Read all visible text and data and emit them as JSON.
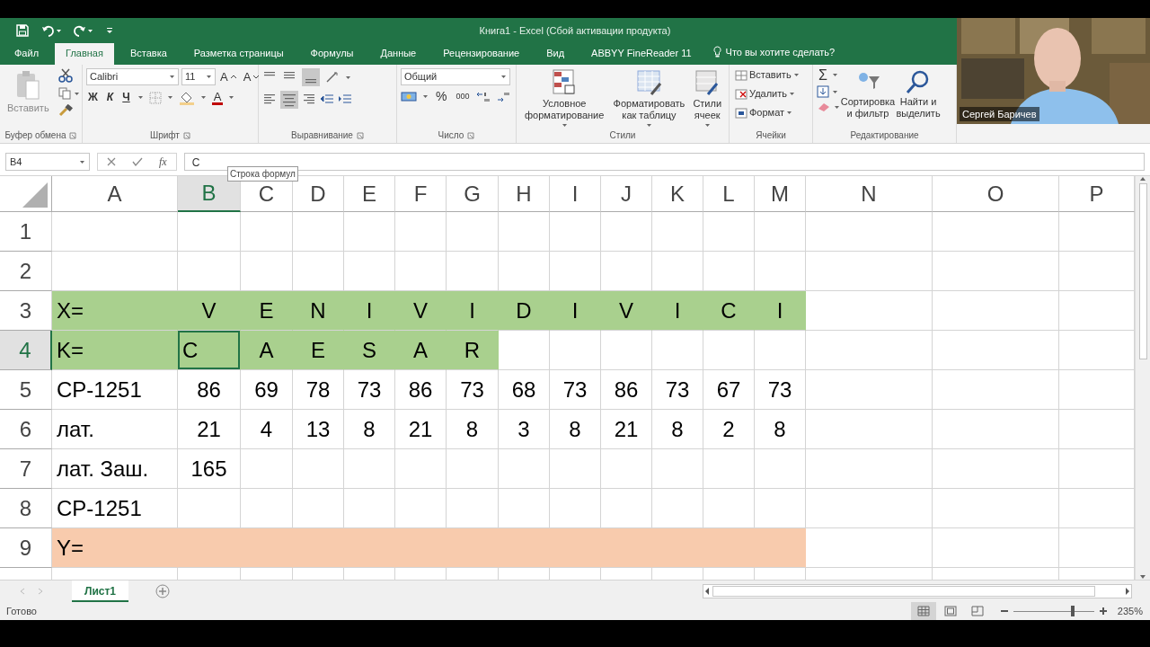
{
  "window": {
    "title": "Книга1 - Excel (Сбой активации продукта)"
  },
  "tabs": [
    {
      "label": "Файл",
      "selected": false
    },
    {
      "label": "Главная",
      "selected": true
    },
    {
      "label": "Вставка",
      "selected": false
    },
    {
      "label": "Разметка страницы",
      "selected": false
    },
    {
      "label": "Формулы",
      "selected": false
    },
    {
      "label": "Данные",
      "selected": false
    },
    {
      "label": "Рецензирование",
      "selected": false
    },
    {
      "label": "Вид",
      "selected": false
    },
    {
      "label": "ABBYY FineReader 11",
      "selected": false
    }
  ],
  "tell_me": "Что вы хотите сделать?",
  "ribbon": {
    "clipboard": {
      "paste": "Вставить",
      "label": "Буфер обмена"
    },
    "font": {
      "name": "Calibri",
      "size": "11",
      "grow": "A",
      "shrink": "A",
      "bold": "Ж",
      "italic": "К",
      "underline": "Ч",
      "font_color": "A",
      "label": "Шрифт"
    },
    "alignment": {
      "label": "Выравнивание"
    },
    "number": {
      "format": "Общий",
      "percent": "%",
      "thousands": "000",
      "label": "Число"
    },
    "styles": {
      "buttons": [
        "Условное форматирование",
        "Форматировать как таблицу",
        "Стили ячеек"
      ],
      "label": "Стили"
    },
    "cells": {
      "buttons": [
        "Вставить",
        "Удалить",
        "Формат"
      ],
      "label": "Ячейки"
    },
    "editing": {
      "sum": "Σ",
      "buttons": [
        "Сортировка и фильтр",
        "Найти и выделить"
      ],
      "label": "Редактирование"
    }
  },
  "formula_bar": {
    "name_box": "B4",
    "function_button": "fx",
    "value": "C",
    "tooltip": "Строка формул"
  },
  "sheet": {
    "columns": [
      {
        "label": "A",
        "selected": false
      },
      {
        "label": "B",
        "selected": true
      },
      {
        "label": "C",
        "selected": false
      },
      {
        "label": "D",
        "selected": false
      },
      {
        "label": "E",
        "selected": false
      },
      {
        "label": "F",
        "selected": false
      },
      {
        "label": "G",
        "selected": false
      },
      {
        "label": "H",
        "selected": false
      },
      {
        "label": "I",
        "selected": false
      },
      {
        "label": "J",
        "selected": false
      },
      {
        "label": "K",
        "selected": false
      },
      {
        "label": "L",
        "selected": false
      },
      {
        "label": "M",
        "selected": false
      },
      {
        "label": "N",
        "selected": false
      },
      {
        "label": "O",
        "selected": false
      },
      {
        "label": "P",
        "selected": false
      }
    ],
    "rows": [
      {
        "number": "1",
        "selected": false,
        "cells": []
      },
      {
        "number": "2",
        "selected": false,
        "cells": []
      },
      {
        "number": "3",
        "selected": false,
        "cells": [
          {
            "text": "X=",
            "kind": "text",
            "color": "#a9d08e"
          },
          {
            "text": "V",
            "color": "#a9d08e"
          },
          {
            "text": "E",
            "color": "#a9d08e"
          },
          {
            "text": "N",
            "color": "#a9d08e"
          },
          {
            "text": "I",
            "color": "#a9d08e"
          },
          {
            "text": "V",
            "color": "#a9d08e"
          },
          {
            "text": "I",
            "color": "#a9d08e"
          },
          {
            "text": "D",
            "color": "#a9d08e"
          },
          {
            "text": "I",
            "color": "#a9d08e"
          },
          {
            "text": "V",
            "color": "#a9d08e"
          },
          {
            "text": "I",
            "color": "#a9d08e"
          },
          {
            "text": "C",
            "color": "#a9d08e"
          },
          {
            "text": "I",
            "color": "#a9d08e"
          }
        ]
      },
      {
        "number": "4",
        "selected": true,
        "cells": [
          {
            "text": "K=",
            "kind": "text",
            "color": "#a9d08e"
          },
          {
            "text": "C",
            "kind": "text",
            "color": "#a9d08e"
          },
          {
            "text": "A",
            "color": "#a9d08e"
          },
          {
            "text": "E",
            "color": "#a9d08e"
          },
          {
            "text": "S",
            "color": "#a9d08e"
          },
          {
            "text": "A",
            "color": "#a9d08e"
          },
          {
            "text": "R",
            "color": "#a9d08e"
          }
        ]
      },
      {
        "number": "5",
        "selected": false,
        "cells": [
          {
            "text": "CP-1251",
            "kind": "text"
          },
          {
            "text": "86"
          },
          {
            "text": "69"
          },
          {
            "text": "78"
          },
          {
            "text": "73"
          },
          {
            "text": "86"
          },
          {
            "text": "73"
          },
          {
            "text": "68"
          },
          {
            "text": "73"
          },
          {
            "text": "86"
          },
          {
            "text": "73"
          },
          {
            "text": "67"
          },
          {
            "text": "73"
          }
        ]
      },
      {
        "number": "6",
        "selected": false,
        "cells": [
          {
            "text": "лат.",
            "kind": "text"
          },
          {
            "text": "21"
          },
          {
            "text": "4"
          },
          {
            "text": "13"
          },
          {
            "text": "8"
          },
          {
            "text": "21"
          },
          {
            "text": "8"
          },
          {
            "text": "3"
          },
          {
            "text": "8"
          },
          {
            "text": "21"
          },
          {
            "text": "8"
          },
          {
            "text": "2"
          },
          {
            "text": "8"
          }
        ]
      },
      {
        "number": "7",
        "selected": false,
        "cells": [
          {
            "text": "лат. Заш.",
            "kind": "text"
          },
          {
            "text": "165"
          }
        ]
      },
      {
        "number": "8",
        "selected": false,
        "cells": [
          {
            "text": "CP-1251",
            "kind": "text"
          }
        ]
      },
      {
        "number": "9",
        "selected": false,
        "cells": [
          {
            "text": "Y=",
            "kind": "text",
            "color": "#f8cbad"
          },
          {
            "color": "#f8cbad"
          },
          {
            "color": "#f8cbad"
          },
          {
            "color": "#f8cbad"
          },
          {
            "color": "#f8cbad"
          },
          {
            "color": "#f8cbad"
          },
          {
            "color": "#f8cbad"
          },
          {
            "color": "#f8cbad"
          },
          {
            "color": "#f8cbad"
          },
          {
            "color": "#f8cbad"
          },
          {
            "color": "#f8cbad"
          },
          {
            "color": "#f8cbad"
          },
          {
            "color": "#f8cbad"
          }
        ]
      }
    ]
  },
  "sheet_tabs": [
    {
      "label": "Лист1",
      "selected": true
    }
  ],
  "status_bar": {
    "text": "Готово",
    "views": [
      {
        "kind": "normal",
        "selected": true
      },
      {
        "kind": "page_layout",
        "selected": false
      },
      {
        "kind": "page_break",
        "selected": false
      }
    ],
    "zoom": {
      "level": 0.73,
      "reading": "235%"
    }
  },
  "webcam": {
    "kind": "picture",
    "name": "Сергей Баричев"
  }
}
